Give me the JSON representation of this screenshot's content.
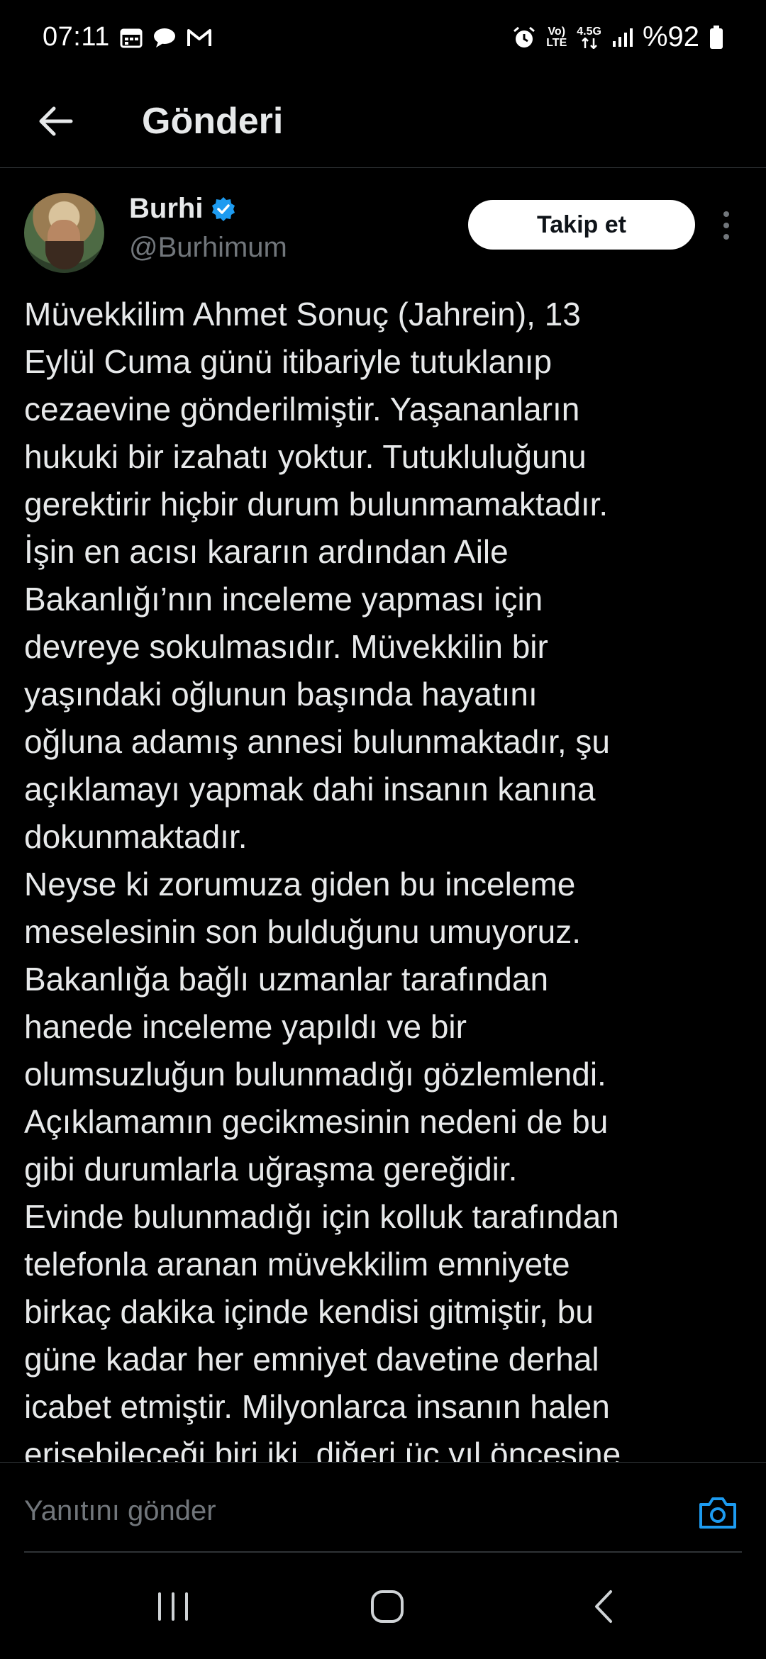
{
  "status_bar": {
    "time": "07:11",
    "network_top": "Vo)",
    "network_bottom": "LTE",
    "network_speed": "4.5G",
    "battery": "%92"
  },
  "header": {
    "title": "Gönderi",
    "back_icon": "arrow-left-icon"
  },
  "post": {
    "author_name": "Burhi",
    "author_handle": "@Burhimum",
    "follow_label": "Takip et",
    "lines": [
      "Müvekkilim Ahmet Sonuç (Jahrein), 13",
      "Eylül Cuma günü itibariyle tutuklanıp",
      "cezaevine gönderilmiştir. Yaşananların",
      "hukuki bir izahatı yoktur. Tutukluluğunu",
      "gerektirir hiçbir durum bulunmamaktadır.",
      "İşin en acısı kararın ardından Aile",
      "Bakanlığı’nın inceleme yapması için",
      "devreye sokulmasıdır. Müvekkilin bir",
      "yaşındaki oğlunun başında hayatını",
      "oğluna adamış annesi bulunmaktadır, şu",
      "açıklamayı yapmak dahi insanın kanına",
      "dokunmaktadır.",
      "Neyse ki zorumuza giden bu inceleme",
      "meselesinin son bulduğunu umuyoruz.",
      "Bakanlığa bağlı uzmanlar tarafından",
      "hanede inceleme yapıldı ve bir",
      "olumsuzluğun bulunmadığı gözlemlendi.",
      "Açıklamamın gecikmesinin nedeni de bu",
      "gibi durumlarla uğraşma gereğidir.",
      "Evinde bulunmadığı için kolluk tarafından",
      "telefonla aranan müvekkilim emniyete",
      "birkaç dakika içinde kendisi gitmiştir, bu",
      "güne kadar her emniyet davetine derhal",
      "icabet etmiştir. Milyonlarca insanın halen",
      "erişebileceği biri iki, diğeri üç yıl öncesine"
    ]
  },
  "reply": {
    "placeholder": "Yanıtını gönder"
  },
  "colors": {
    "background": "#000000",
    "text": "#e7e9ea",
    "secondary_text": "#71767b",
    "accent": "#1d9bf0",
    "divider": "#2f3336"
  }
}
